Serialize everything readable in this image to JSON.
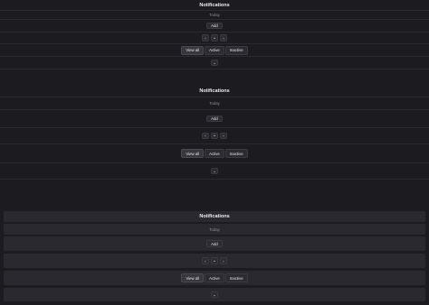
{
  "sections": [
    {
      "title": "Notifications",
      "subtitle": "Today",
      "add_label": "Add",
      "pagination": [
        "‹",
        "•",
        "›"
      ],
      "filters": [
        "View all",
        "Active",
        "Inactive"
      ],
      "more_label": "⌄"
    },
    {
      "title": "Notifications",
      "subtitle": "Today",
      "add_label": "Add",
      "pagination": [
        "‹",
        "•",
        "›"
      ],
      "filters": [
        "View all",
        "Active",
        "Inactive"
      ],
      "more_label": "⌄"
    },
    {
      "title": "Notifications",
      "subtitle": "Today",
      "add_label": "Add",
      "pagination": [
        "‹",
        "•",
        "›"
      ],
      "filters": [
        "View all",
        "Active",
        "Inactive"
      ],
      "more_label": "⌄"
    }
  ]
}
